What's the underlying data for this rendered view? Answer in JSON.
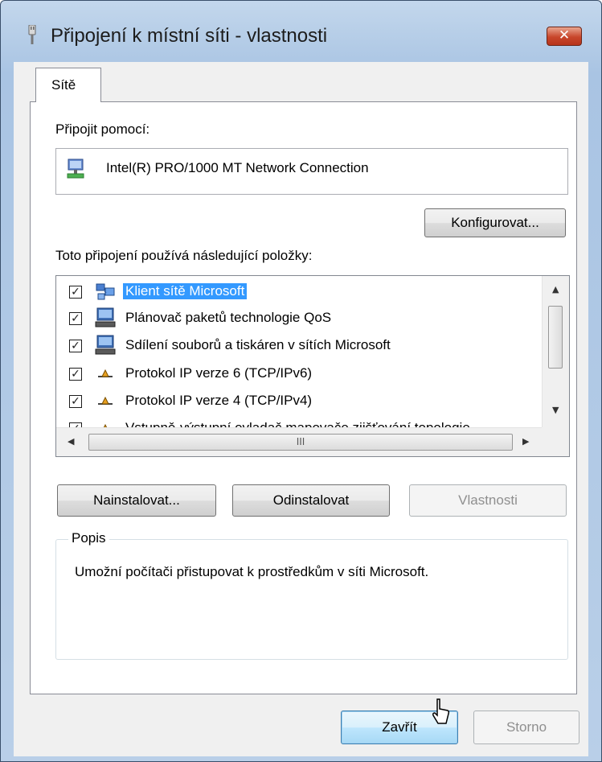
{
  "window": {
    "title": "Připojení k místní síti - vlastnosti",
    "close_label": "✕"
  },
  "tabs": [
    {
      "label": "Sítě",
      "selected": true
    }
  ],
  "connect": {
    "label": "Připojit pomocí:",
    "adapter": "Intel(R) PRO/1000 MT Network Connection",
    "configure_button": "Konfigurovat..."
  },
  "items": {
    "label": "Toto připojení používá následující položky:",
    "list": [
      {
        "label": "Klient sítě Microsoft",
        "checked": true,
        "selected": true,
        "icon": "network-client-icon"
      },
      {
        "label": "Plánovač paketů technologie QoS",
        "checked": true,
        "selected": false,
        "icon": "computer-icon"
      },
      {
        "label": "Sdílení souborů a tiskáren v sítích Microsoft",
        "checked": true,
        "selected": false,
        "icon": "computer-icon"
      },
      {
        "label": "Protokol IP verze 6 (TCP/IPv6)",
        "checked": true,
        "selected": false,
        "icon": "protocol-icon"
      },
      {
        "label": "Protokol IP verze 4 (TCP/IPv4)",
        "checked": true,
        "selected": false,
        "icon": "protocol-icon"
      },
      {
        "label": "Vstupně-výstupní ovladač mapovače zjišťování topologie",
        "checked": true,
        "selected": false,
        "icon": "protocol-icon"
      }
    ],
    "scroll_thumb_grip": "III"
  },
  "buttons": {
    "install": "Nainstalovat...",
    "uninstall": "Odinstalovat",
    "properties": "Vlastnosti",
    "close": "Zavřít",
    "cancel": "Storno"
  },
  "description": {
    "title": "Popis",
    "text": "Umožní počítači přistupovat k prostředkům v síti Microsoft."
  },
  "colors": {
    "selection": "#3399ff",
    "title_bar": "#b9d1ea",
    "close_button": "#c8462b"
  }
}
